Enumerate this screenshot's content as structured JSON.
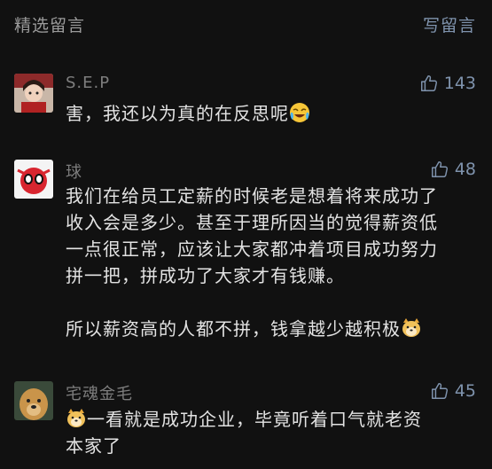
{
  "header": {
    "title": "精选留言",
    "write_label": "写留言"
  },
  "colors": {
    "background": "#111111",
    "link": "#7f93ad",
    "nickname": "#7d7d7d",
    "text": "#e3e3e3"
  },
  "comments": [
    {
      "nickname": "S.E.P",
      "likes": "143",
      "text": "害，我还以为真的在反思呢",
      "trailing_emoji": "laughing-crying-emoji"
    },
    {
      "nickname": "球",
      "likes": "48",
      "lines": [
        "我们在给员工定薪的时候老是想着将来成功了",
        "收入会是多少。甚至于理所因当的觉得薪资低",
        "一点很正常，应该让大家都冲着项目成功努力",
        "拼一把，拼成功了大家才有钱赚。"
      ],
      "last_line": "所以薪资高的人都不拼，钱拿越少越积极",
      "trailing_emoji": "doge-emoji"
    },
    {
      "nickname": "宅魂金毛",
      "likes": "45",
      "line1": "一看就是成功企业，毕竟听着口气就老资",
      "line2": "本家了",
      "leading_emoji": "doge-emoji"
    }
  ]
}
